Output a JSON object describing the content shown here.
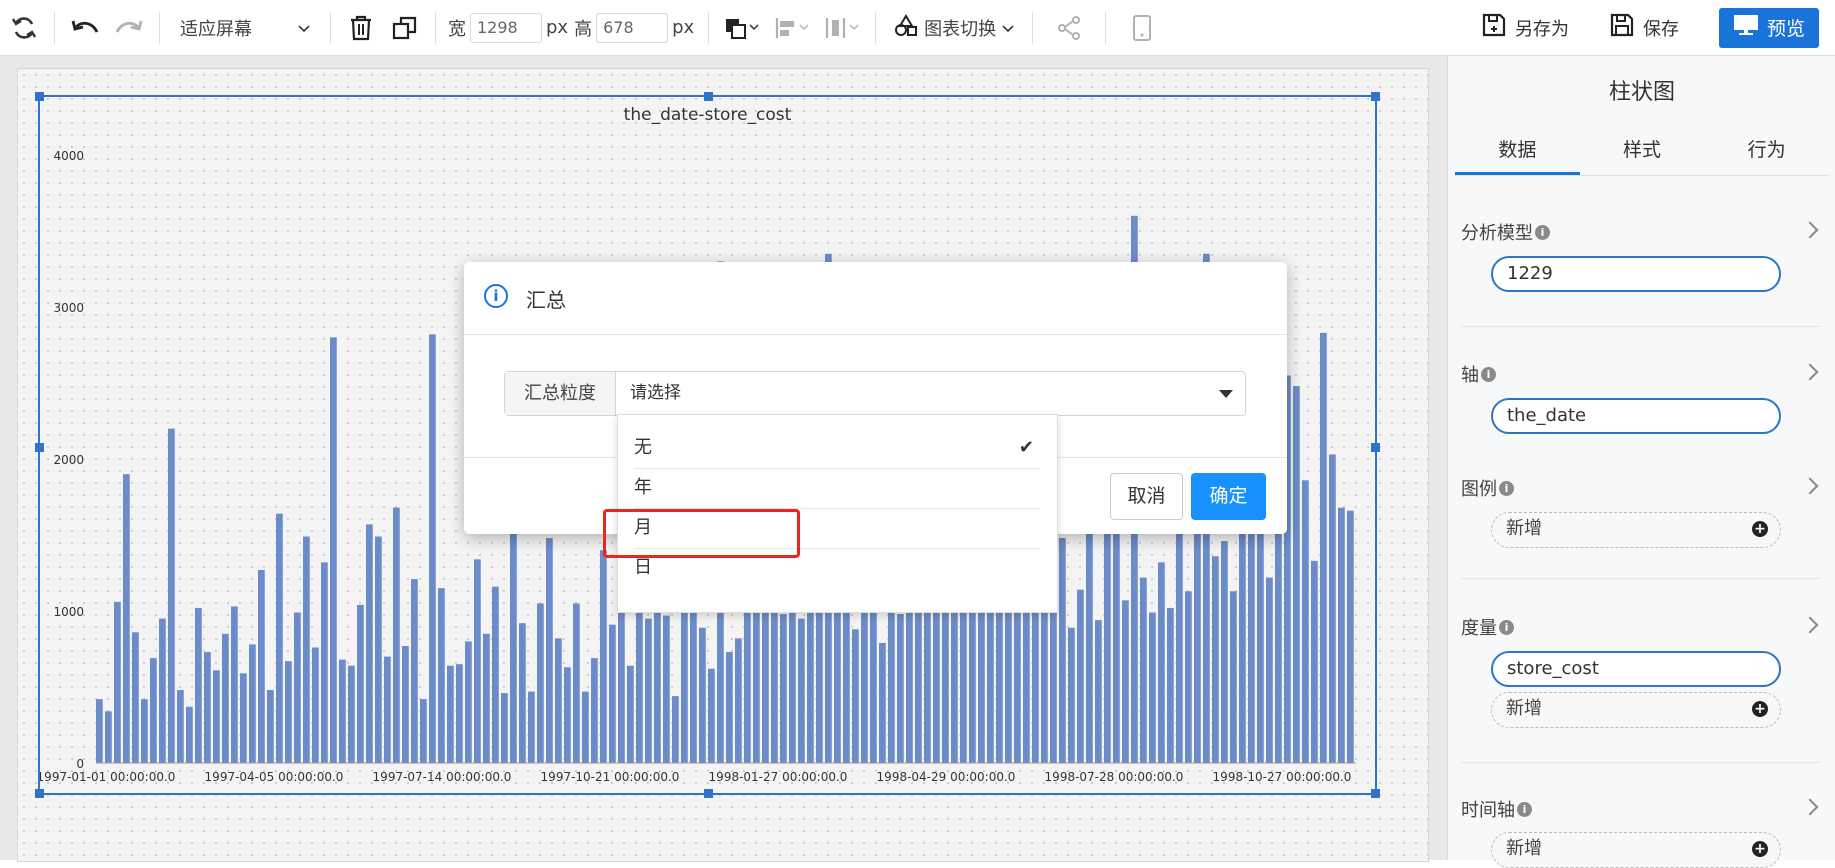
{
  "toolbar": {
    "zoom_label": "适应屏幕",
    "width_label": "宽",
    "width_value": "1298",
    "height_label": "高",
    "height_value": "678",
    "unit": "px",
    "chart_switch_label": "图表切换",
    "save_as_label": "另存为",
    "save_label": "保存",
    "preview_label": "预览"
  },
  "panel": {
    "title": "柱状图",
    "tabs": [
      "数据",
      "样式",
      "行为"
    ],
    "model_label": "分析模型",
    "model_value": "1229",
    "axis_label": "轴",
    "axis_value": "the_date",
    "legend_label": "图例",
    "add_label": "新增",
    "measure_label": "度量",
    "measure_value": "store_cost",
    "timeline_label": "时间轴"
  },
  "modal": {
    "title": "汇总",
    "field_label": "汇总粒度",
    "placeholder": "请选择",
    "cancel_label": "取消",
    "ok_label": "确定",
    "options": [
      "无",
      "年",
      "月",
      "日"
    ]
  },
  "colors": {
    "accent": "#1a73d9",
    "bar": "#6b8cc8",
    "highlight": "#e8261f"
  },
  "chart_data": {
    "type": "bar",
    "title": "the_date-store_cost",
    "xlabel": "",
    "ylabel": "",
    "ylim": [
      0,
      4000
    ],
    "yticks": [
      "4000",
      "3000",
      "2000",
      "1000",
      "0"
    ],
    "xtick_labels": [
      "1997-01-01 00:00:00.0",
      "1997-04-05 00:00:00.0",
      "1997-07-14 00:00:00.0",
      "1997-10-21 00:00:00.0",
      "1998-01-27 00:00:00.0",
      "1998-04-29 00:00:00.0",
      "1998-07-28 00:00:00.0",
      "1998-10-27 00:00:00.0"
    ],
    "values": [
      420,
      340,
      1060,
      1900,
      860,
      420,
      690,
      950,
      2200,
      480,
      370,
      1020,
      730,
      610,
      850,
      1030,
      590,
      780,
      1270,
      480,
      1640,
      670,
      990,
      1490,
      760,
      1320,
      2800,
      680,
      640,
      1040,
      1570,
      1490,
      700,
      1680,
      770,
      1210,
      420,
      2820,
      1150,
      640,
      650,
      800,
      1340,
      850,
      1160,
      460,
      1710,
      920,
      470,
      1050,
      1480,
      820,
      630,
      1050,
      470,
      690,
      1400,
      910,
      1650,
      640,
      1230,
      950,
      1540,
      970,
      440,
      1560,
      1280,
      890,
      620,
      3300,
      730,
      820,
      1570,
      1140,
      1500,
      1020,
      980,
      1860,
      950,
      990,
      1020,
      3350,
      1090,
      1850,
      880,
      1050,
      1120,
      790,
      1320,
      980,
      1240,
      1780,
      990,
      1240,
      1380,
      990,
      1040,
      2030,
      1290,
      1240,
      1020,
      2370,
      1280,
      1720,
      1050,
      1560,
      1080,
      1480,
      890,
      1140,
      1820,
      940,
      1650,
      1560,
      1070,
      3600,
      1220,
      990,
      1320,
      1020,
      1510,
      1130,
      1720,
      3350,
      1360,
      1460,
      1130,
      2600,
      2780,
      1850,
      1220,
      2900,
      2550,
      2480,
      1860,
      1330,
      2830,
      2030,
      1680,
      1660
    ],
    "grid": false
  }
}
